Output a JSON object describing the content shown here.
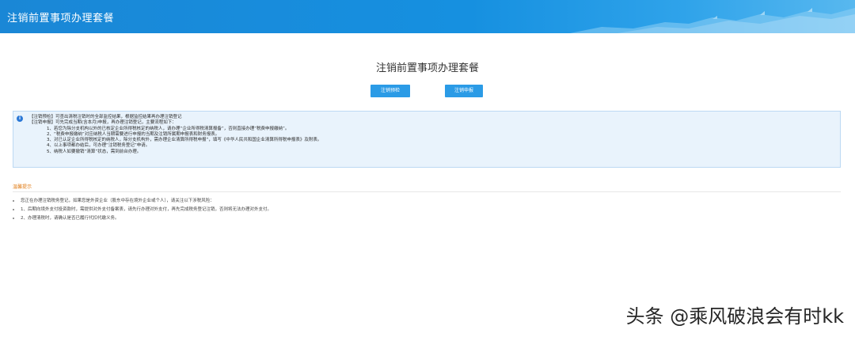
{
  "header": {
    "title": "注销前置事项办理套餐"
  },
  "main": {
    "title": "注销前置事项办理套餐",
    "buttons": {
      "check": "注销预检",
      "apply": "注销申报"
    }
  },
  "notice": {
    "lines": [
      "【注销预检】可查出清税注销时的全部监控结果，根据监控结果再办理注销登记",
      "【注销申报】可先完成当期(含本月)申报，再办理注销登记，主要流程如下：",
      "1、若您为除分支机构以外的已核定企业所得税核定的纳税人，请办理“企业所得税清算报备”，否则直接办理“税费申报缴纳”。",
      "2、“税费申报缴纳”对应纳税人当期需要进行申报的当期及注销所属期申报表和财务报表。",
      "3、对已认定企业所得税核定的纳税人，除分支机构外，需办理企业清算所得税申报”，填写《中华人民共和国企业清算所得税申报表》及附表。",
      "4、以上事项都办结后，可办理“注销税务登记”申请。",
      "5、纳税人如要撤销“清算”状态，需到前台办理。"
    ]
  },
  "tips": {
    "title": "温馨提示",
    "items": [
      "您正在办理注销税务登记，如果您是外资企业（股东中存在境外企业或个人），请关注以下涉税风险：",
      "1、后期向境外支付投资款时，需提供对外支付备案表，请先行办理对外支付，再先完成税务登记注销，否则将无法办理对外支付。",
      "2、办理清税时，请确认是否已履行代扣代缴义务。"
    ]
  },
  "watermark": {
    "text": "头条 @乘风破浪会有时kk"
  },
  "colors": {
    "header_blue": "#1a87d6",
    "button_blue": "#2b9be6",
    "notice_bg": "#e9f3fc",
    "tips_orange": "#e07a13"
  },
  "icons": {
    "notice": "info-icon"
  }
}
